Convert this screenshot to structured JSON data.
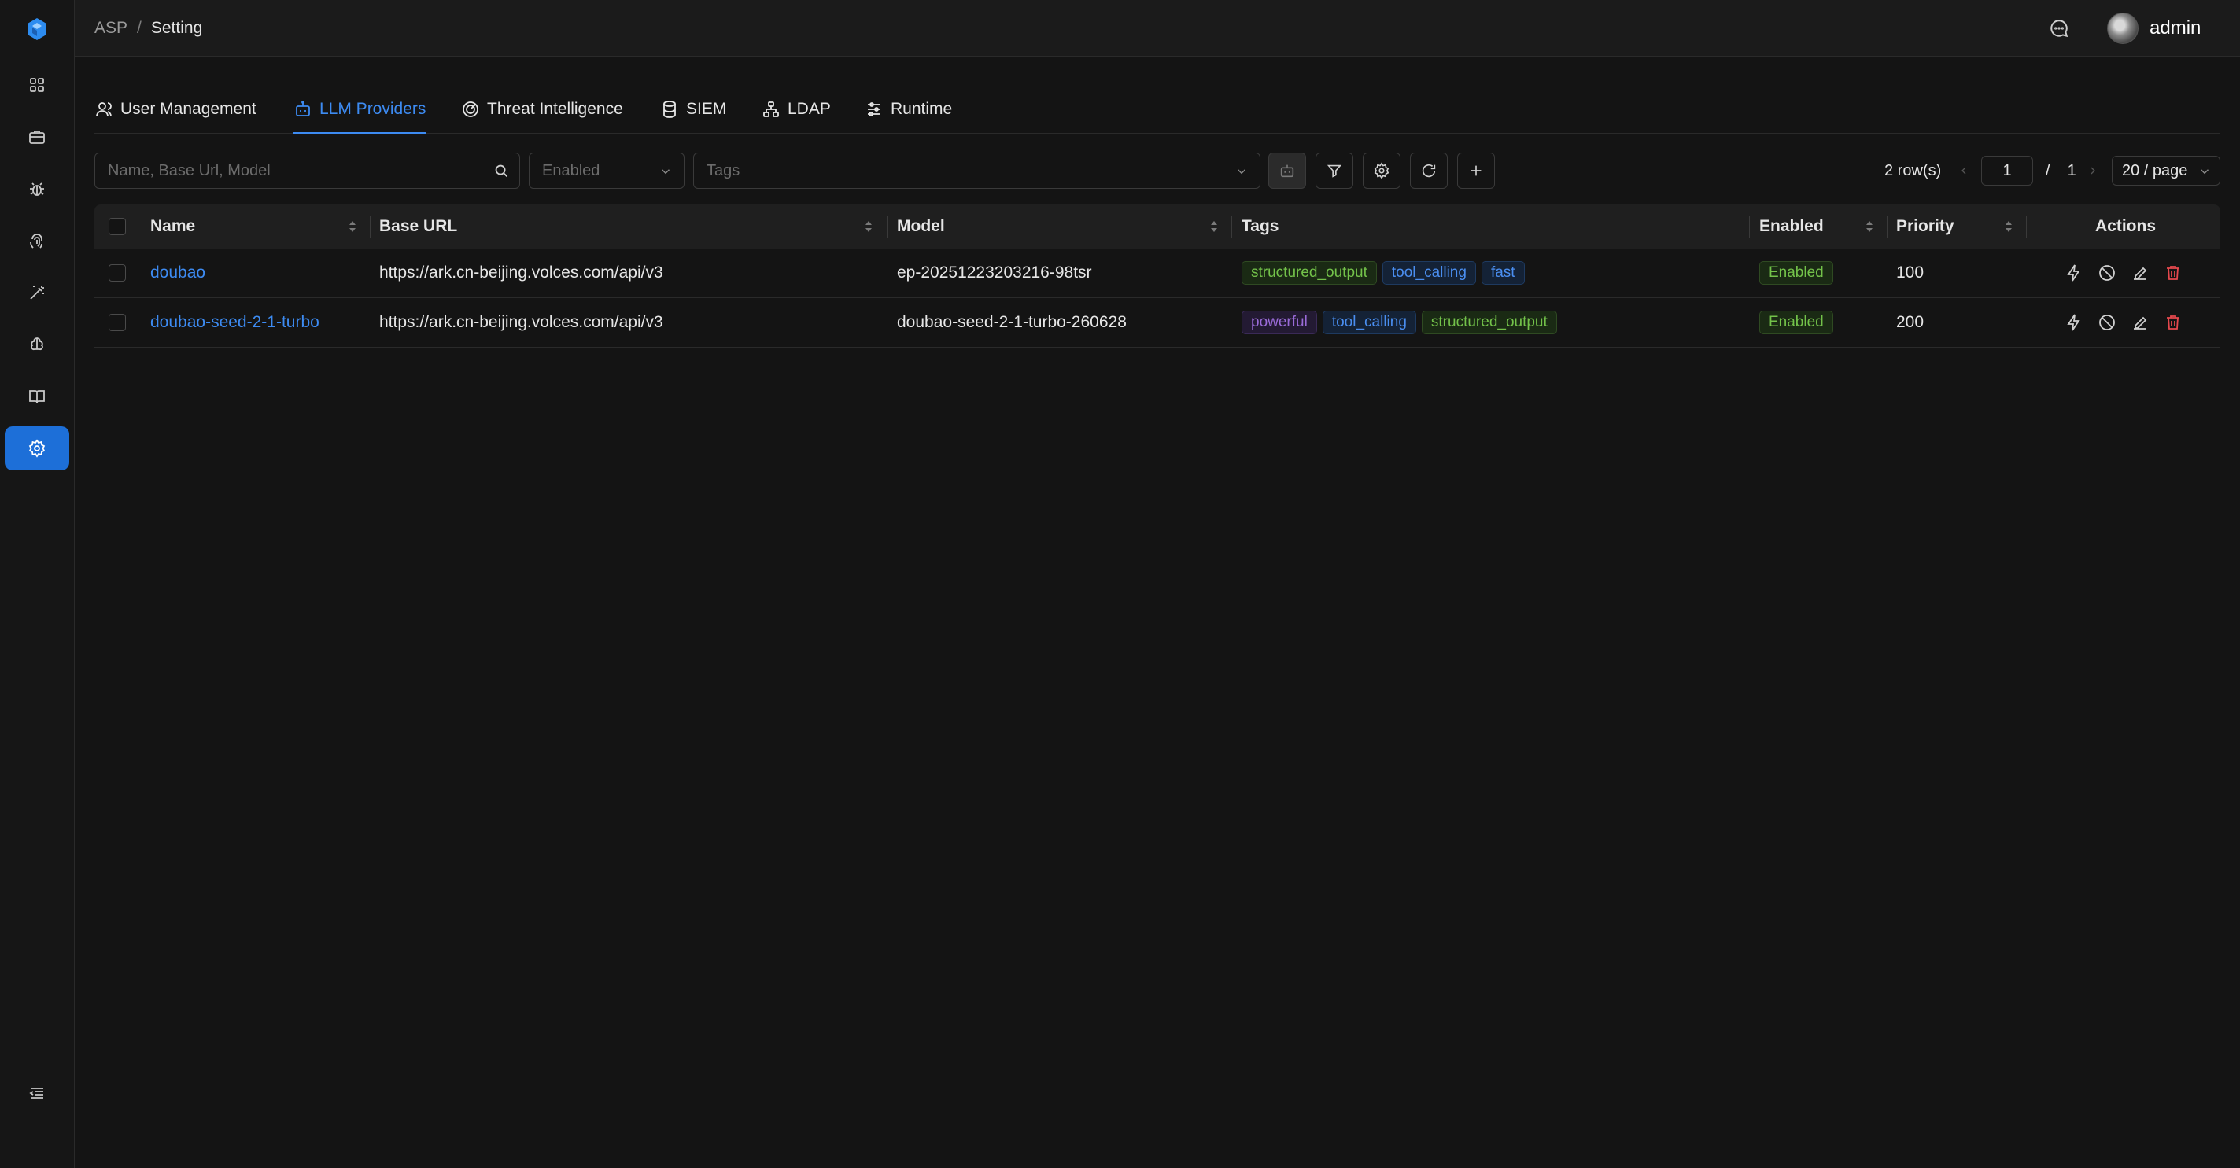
{
  "header": {
    "breadcrumb_root": "ASP",
    "breadcrumb_sep": "/",
    "breadcrumb_current": "Setting",
    "username": "admin"
  },
  "sidebar": {
    "items": [
      {
        "icon": "dashboard-icon"
      },
      {
        "icon": "briefcase-icon"
      },
      {
        "icon": "bug-icon"
      },
      {
        "icon": "fingerprint-icon"
      },
      {
        "icon": "magic-wand-icon"
      },
      {
        "icon": "brain-icon"
      },
      {
        "icon": "book-icon"
      },
      {
        "icon": "gear-icon",
        "active": true
      }
    ],
    "collapse_icon": "collapse-menu-icon"
  },
  "tabs": [
    {
      "label": "User Management",
      "icon": "user-icon"
    },
    {
      "label": "LLM Providers",
      "icon": "robot-icon",
      "active": true
    },
    {
      "label": "Threat Intelligence",
      "icon": "radar-icon"
    },
    {
      "label": "SIEM",
      "icon": "database-icon"
    },
    {
      "label": "LDAP",
      "icon": "network-icon"
    },
    {
      "label": "Runtime",
      "icon": "sliders-icon"
    }
  ],
  "toolbar": {
    "search_placeholder": "Name, Base Url, Model",
    "enabled_placeholder": "Enabled",
    "tags_placeholder": "Tags",
    "rows_count": "2 row(s)",
    "page_current": "1",
    "page_sep": "/",
    "page_total": "1",
    "page_size": "20 / page"
  },
  "table": {
    "columns": {
      "name": "Name",
      "base_url": "Base URL",
      "model": "Model",
      "tags": "Tags",
      "enabled": "Enabled",
      "priority": "Priority",
      "actions": "Actions"
    },
    "rows": [
      {
        "name": "doubao",
        "base_url": "https://ark.cn-beijing.volces.com/api/v3",
        "model": "ep-20251223203216-98tsr",
        "tags": [
          {
            "label": "structured_output",
            "color": "green"
          },
          {
            "label": "tool_calling",
            "color": "blue"
          },
          {
            "label": "fast",
            "color": "blue"
          }
        ],
        "enabled": "Enabled",
        "priority": "100"
      },
      {
        "name": "doubao-seed-2-1-turbo",
        "base_url": "https://ark.cn-beijing.volces.com/api/v3",
        "model": "doubao-seed-2-1-turbo-260628",
        "tags": [
          {
            "label": "powerful",
            "color": "purple"
          },
          {
            "label": "tool_calling",
            "color": "blue"
          },
          {
            "label": "structured_output",
            "color": "green"
          }
        ],
        "enabled": "Enabled",
        "priority": "200"
      }
    ]
  },
  "colors": {
    "accent": "#3d8bf2",
    "sidebar_active": "#1d6fd8",
    "tag_green": "#73c24a",
    "tag_blue": "#4a8ef0",
    "tag_purple": "#9a6bd8",
    "danger": "#e5484d"
  }
}
